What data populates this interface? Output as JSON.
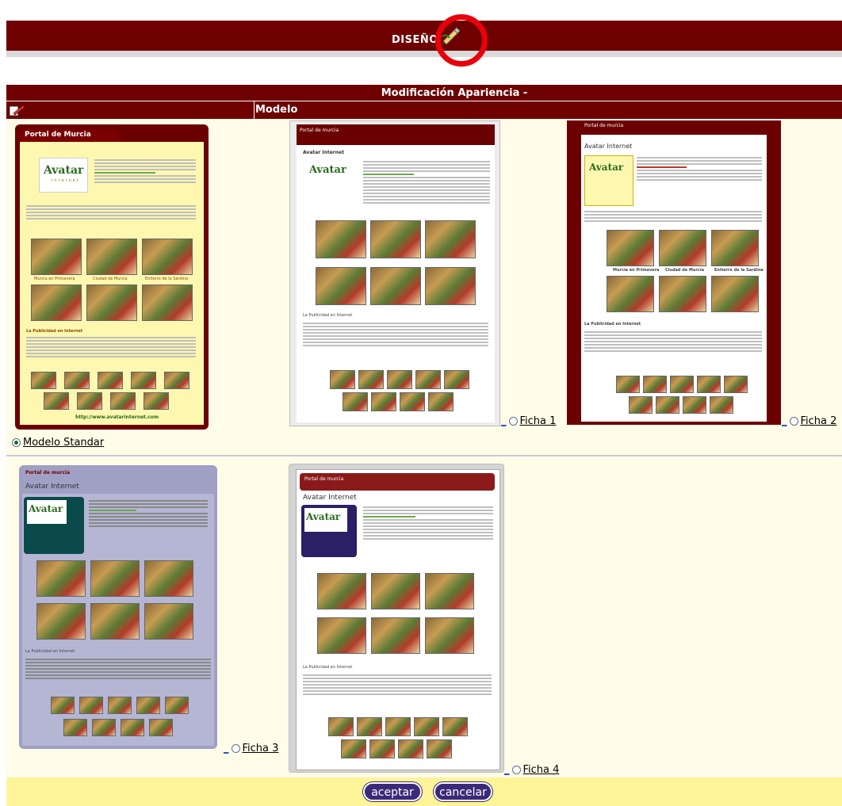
{
  "header": {
    "title": "DISEÑO"
  },
  "section": {
    "title": "Modificación Apariencia -",
    "column_title": "Modelo"
  },
  "options": [
    {
      "label": "Modelo Standar",
      "selected": true,
      "prefix": ""
    },
    {
      "label": "Ficha 1",
      "selected": false,
      "prefix": "_"
    },
    {
      "label": "Ficha 2",
      "selected": false,
      "prefix": "_"
    },
    {
      "label": "Ficha 3",
      "selected": false,
      "prefix": "_"
    },
    {
      "label": "Ficha 4",
      "selected": false,
      "prefix": "_"
    }
  ],
  "thumbs": {
    "standar": {
      "title": "Portal de Murcia",
      "logo": "Avatar",
      "logo_sub": "internet",
      "url": "http://www.avatarinternet.com",
      "section": "La Publicidad en Internet",
      "captions": [
        "Murcia en Primavera",
        "Ciudad de Murcia",
        "Entierro de la Sardina"
      ]
    },
    "ficha1": {
      "title": "Portal de murcia",
      "heading": "Avatar Internet",
      "logo": "Avatar",
      "section": "La Publicidad en Internet"
    },
    "ficha2": {
      "title": "Portal de murcia",
      "heading": "Avatar Internet",
      "logo": "Avatar",
      "section": "La Publicidad en Internet",
      "captions": [
        "Murcia en Primavera",
        "Ciudad de Murcia",
        "Entierro de la Sardina"
      ]
    },
    "ficha3": {
      "title": "Portal de murcia",
      "heading": "Avatar Internet",
      "logo": "Avatar",
      "section": "La Publicidad en Internet"
    },
    "ficha4": {
      "title": "Portal de murcia",
      "heading": "Avatar Internet",
      "logo": "Avatar",
      "section": "La Publicidad en Internet"
    }
  },
  "buttons": {
    "accept": "aceptar",
    "cancel": "cancelar"
  },
  "colors": {
    "header_bg": "#6e0000",
    "row_bg": "#fffce8",
    "footer_bg": "#fef59a",
    "button_bg": "#3b2a78",
    "highlight_ring": "#e8000b"
  },
  "icons": [
    "pen-icon",
    "edit-icon"
  ]
}
